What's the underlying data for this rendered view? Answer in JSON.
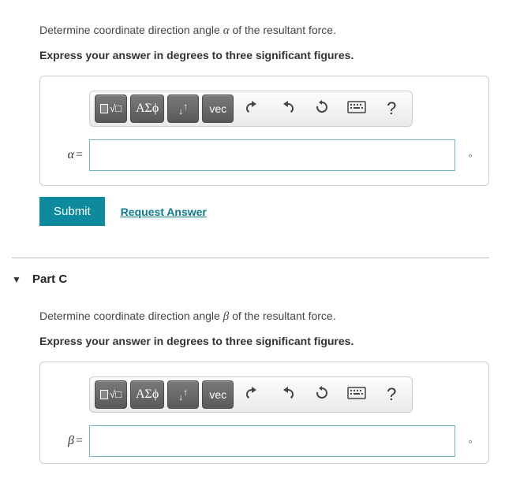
{
  "partB": {
    "prompt_pre": "Determine coordinate direction angle ",
    "prompt_var": "α",
    "prompt_post": " of the resultant force.",
    "instruction": "Express your answer in degrees to three significant figures.",
    "lhs_var": "α",
    "lhs_eq": "=",
    "unit": "∘",
    "input_value": ""
  },
  "toolbar": {
    "templates_tip": "Templates",
    "symbols_label": "ΑΣϕ",
    "subsup_tip": "Subscript/Superscript",
    "vec_label": "vec",
    "undo_tip": "Undo",
    "redo_tip": "Redo",
    "reset_tip": "Reset",
    "keyboard_tip": "Keyboard",
    "help_label": "?"
  },
  "actions": {
    "submit": "Submit",
    "request": "Request Answer"
  },
  "partC": {
    "header": "Part C",
    "prompt_pre": "Determine coordinate direction angle ",
    "prompt_var": "β",
    "prompt_post": " of the resultant force.",
    "instruction": "Express your answer in degrees to three significant figures.",
    "lhs_var": "β",
    "lhs_eq": "=",
    "unit": "∘",
    "input_value": ""
  }
}
